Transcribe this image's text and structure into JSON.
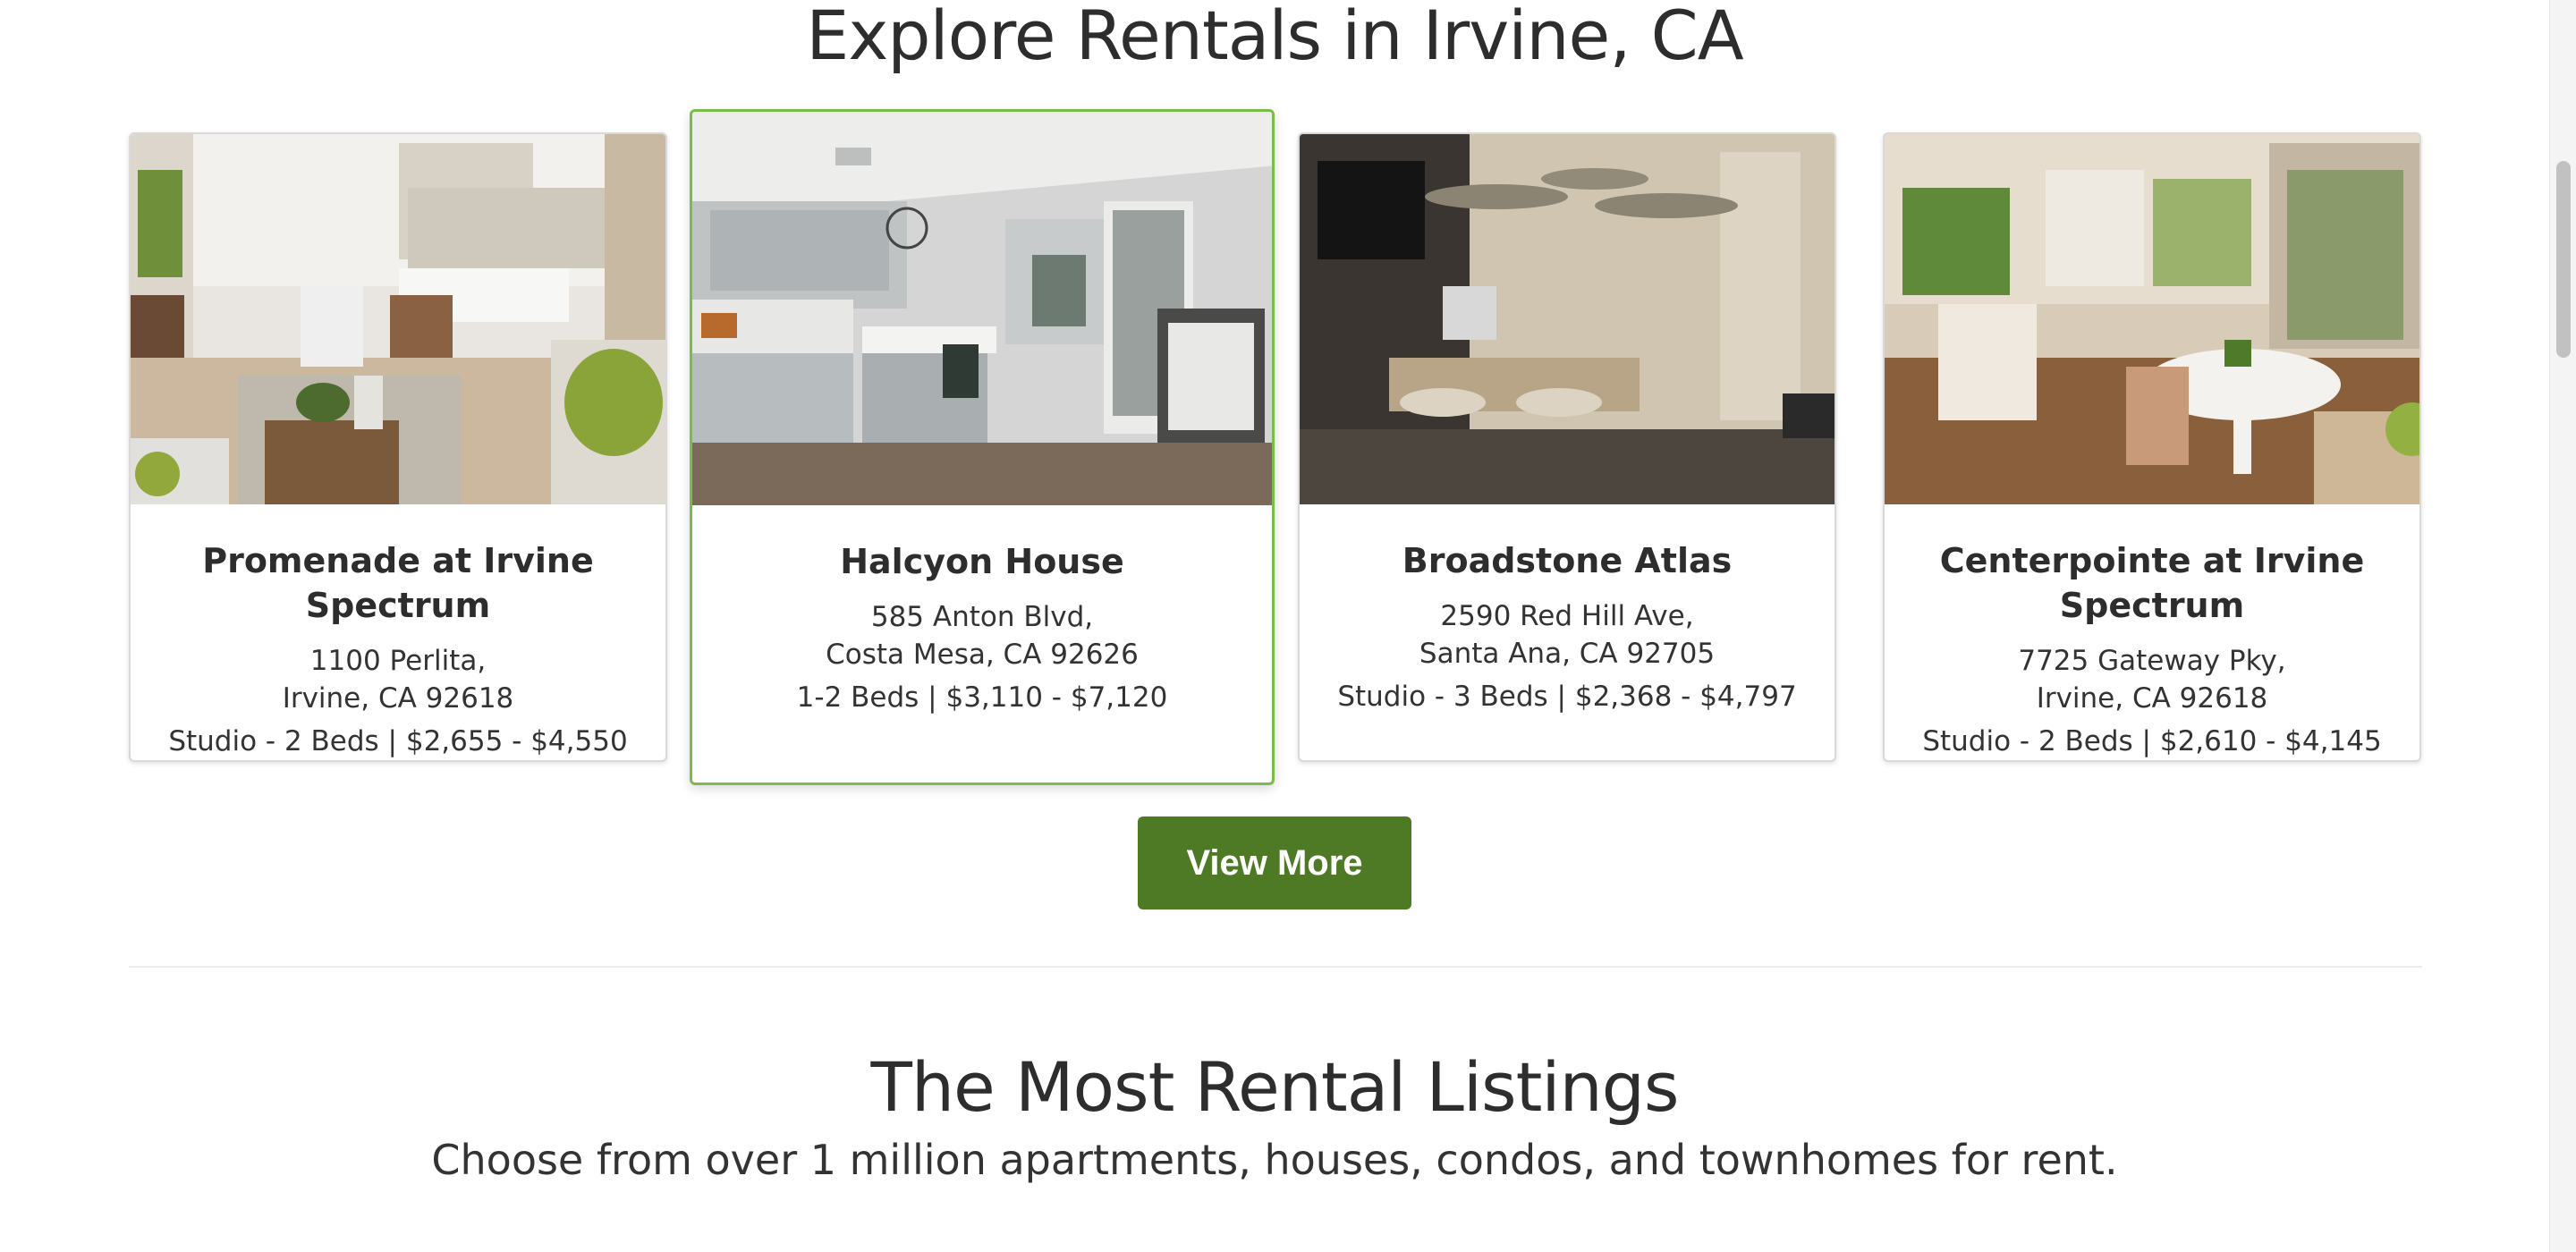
{
  "heading_explore": "Explore Rentals in Irvine, CA",
  "listings": [
    {
      "name": "Promenade at Irvine Spectrum",
      "address_line1": "1100 Perlita,",
      "address_line2": "Irvine, CA 92618",
      "price": "Studio - 2 Beds | $2,655 - $4,550"
    },
    {
      "name": "Halcyon House",
      "address_line1": "585 Anton Blvd,",
      "address_line2": "Costa Mesa, CA 92626",
      "price": "1-2 Beds | $3,110 - $7,120"
    },
    {
      "name": "Broadstone Atlas",
      "address_line1": "2590 Red Hill Ave,",
      "address_line2": "Santa Ana, CA 92705",
      "price": "Studio - 3 Beds | $2,368 - $4,797"
    },
    {
      "name": "Centerpointe at Irvine Spectrum",
      "address_line1": "7725 Gateway Pky,",
      "address_line2": "Irvine, CA 92618",
      "price": "Studio - 2 Beds | $2,610 - $4,145"
    }
  ],
  "view_more_label": "View More",
  "heading_most": "The Most Rental Listings",
  "subheading_most": "Choose from over 1 million apartments, houses, condos, and townhomes for rent.",
  "colors": {
    "accent_green": "#4e7a26",
    "featured_border": "#7cbc4a"
  }
}
